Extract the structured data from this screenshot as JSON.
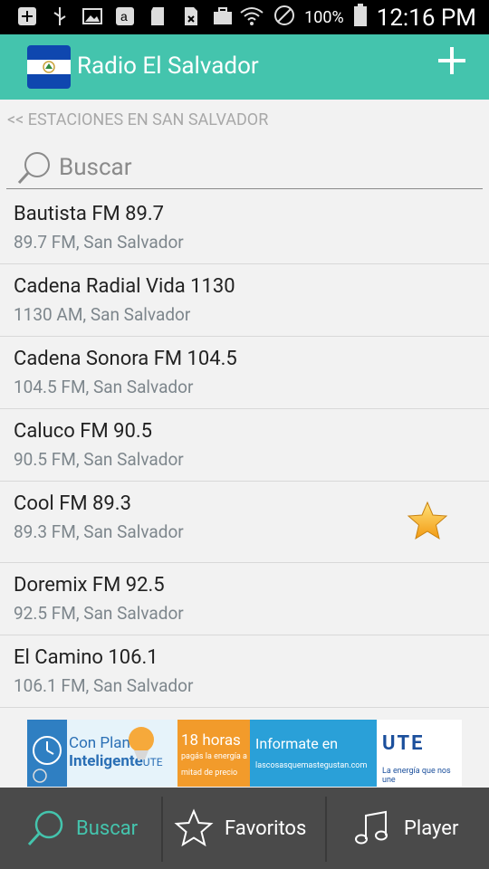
{
  "status_bar": {
    "battery": "100%",
    "time": "12:16 PM",
    "icons": [
      "plus-icon",
      "usb-icon",
      "image-icon",
      "amazon-icon",
      "sd-card-icon",
      "no-sim-icon",
      "briefcase-icon",
      "wifi-icon",
      "blocked-icon",
      "battery-icon"
    ]
  },
  "app_bar": {
    "title": "Radio El Salvador",
    "flag_colors": {
      "blue": "#0f47af",
      "white": "#ffffff"
    },
    "accent": "#44c4ad"
  },
  "breadcrumb": "<< ESTACIONES EN SAN SALVADOR",
  "search": {
    "placeholder": "Buscar",
    "value": ""
  },
  "stations": [
    {
      "name": "Bautista FM 89.7",
      "detail": "89.7 FM, San Salvador",
      "favorite": false
    },
    {
      "name": "Cadena Radial Vida 1130",
      "detail": "1130 AM, San Salvador",
      "favorite": false
    },
    {
      "name": "Cadena Sonora FM 104.5",
      "detail": "104.5 FM, San Salvador",
      "favorite": false
    },
    {
      "name": "Caluco FM 90.5",
      "detail": "90.5 FM, San Salvador",
      "favorite": false
    },
    {
      "name": "Cool FM 89.3",
      "detail": "89.3 FM, San Salvador",
      "favorite": true
    },
    {
      "name": "Doremix FM 92.5",
      "detail": "92.5 FM, San Salvador",
      "favorite": false
    },
    {
      "name": "El Camino 106.1",
      "detail": "106.1 FM, San Salvador",
      "favorite": false
    }
  ],
  "ad_banner": {
    "plan_text_1": "Con Plan",
    "plan_text_2": "Inteligente",
    "plan_text_3": "UTE",
    "hours_title": "18 horas",
    "hours_sub": "pagás la energía a mitad de precio",
    "info_title": "Informate en",
    "info_sub": "lascosasquemastegustan.com",
    "brand": "UTE",
    "brand_tagline": "La energía que nos une"
  },
  "bottom_nav": [
    {
      "label": "Buscar",
      "icon": "search-icon",
      "active": true
    },
    {
      "label": "Favoritos",
      "icon": "star-outline-icon",
      "active": false
    },
    {
      "label": "Player",
      "icon": "music-note-icon",
      "active": false
    }
  ],
  "colors": {
    "active_tab": "#44c4ad",
    "bottom_bar": "#4a4a4a",
    "star": "#f7b21b"
  }
}
